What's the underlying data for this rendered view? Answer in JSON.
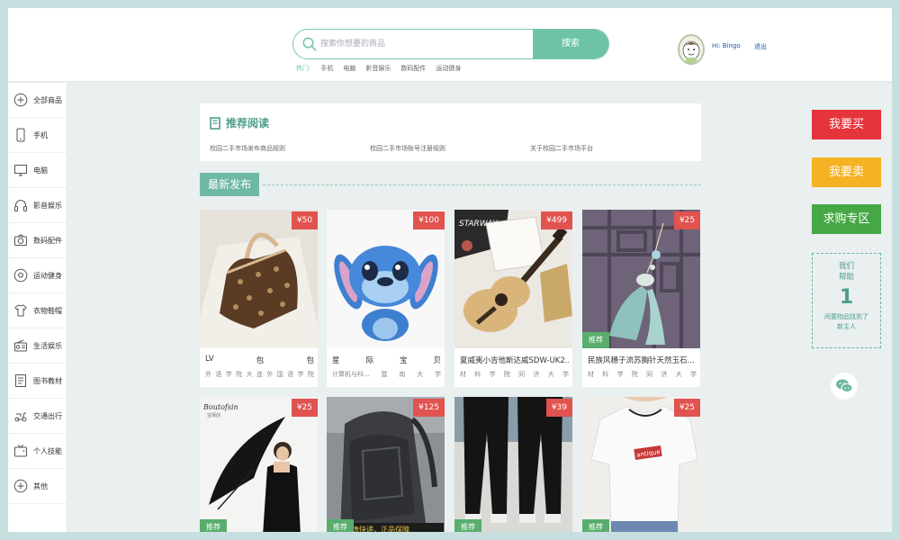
{
  "header": {
    "search": {
      "placeholder": "搜索你想要的商品",
      "button": "搜索"
    },
    "hot": {
      "label": "热门:",
      "items": [
        "手机",
        "电脑",
        "影音娱乐",
        "数码配件",
        "运动健身"
      ]
    },
    "user": {
      "greeting": "Hi: Bingo",
      "logout": "退出"
    }
  },
  "sidebar": {
    "items": [
      {
        "label": "全部商品",
        "icon": "plus-circle-icon"
      },
      {
        "label": "手机",
        "icon": "phone-icon"
      },
      {
        "label": "电脑",
        "icon": "monitor-icon"
      },
      {
        "label": "影音娱乐",
        "icon": "headphones-icon"
      },
      {
        "label": "数码配件",
        "icon": "camera-icon"
      },
      {
        "label": "运动健身",
        "icon": "ball-icon"
      },
      {
        "label": "衣物鞋帽",
        "icon": "shirt-icon"
      },
      {
        "label": "生活娱乐",
        "icon": "radio-icon"
      },
      {
        "label": "图书教材",
        "icon": "book-icon"
      },
      {
        "label": "交通出行",
        "icon": "scooter-icon"
      },
      {
        "label": "个人技能",
        "icon": "tv-icon"
      },
      {
        "label": "其他",
        "icon": "plus-circle-icon"
      }
    ]
  },
  "recommend": {
    "title": "推荐阅读",
    "links": [
      "校园二手市场发布商品规则",
      "校园二手市场账号注册规则",
      "关于校园二手市场平台"
    ]
  },
  "latest": {
    "title": "最新发布"
  },
  "products": [
    {
      "price": "¥50",
      "title": [
        "LV",
        "包",
        "包"
      ],
      "school": [
        "外",
        "语",
        "学",
        "院",
        "大",
        "连",
        "外",
        "国",
        "语",
        "学",
        "院"
      ],
      "tag": ""
    },
    {
      "price": "¥100",
      "title": [
        "星",
        "际",
        "宝",
        "贝"
      ],
      "school": [
        "计算机与科...",
        "暨",
        "南",
        "大",
        "学"
      ],
      "tag": ""
    },
    {
      "price": "¥499",
      "title": [
        "夏威夷小吉他斯达威SDW-UK2..."
      ],
      "school": [
        "材",
        "料",
        "学",
        "院",
        "同",
        "济",
        "大",
        "学"
      ],
      "tag": ""
    },
    {
      "price": "¥25",
      "title": [
        "民族风穗子流苏胸针天然玉石..."
      ],
      "school": [
        "材",
        "料",
        "学",
        "院",
        "同",
        "济",
        "大",
        "学"
      ],
      "tag": "推荐"
    },
    {
      "price": "¥25",
      "title": [
        ""
      ],
      "school": [],
      "tag": "推荐"
    },
    {
      "price": "¥125",
      "title": [
        ""
      ],
      "school": [],
      "tag": "推荐"
    },
    {
      "price": "¥39",
      "title": [
        ""
      ],
      "school": [],
      "tag": "推荐"
    },
    {
      "price": "¥25",
      "title": [
        ""
      ],
      "school": [],
      "tag": "推荐"
    }
  ],
  "product_banner": "安逸快递，正品保障",
  "right_panel": {
    "buy": "我要买",
    "sell": "我要卖",
    "wanted": "求购专区",
    "help_line1": "我们",
    "help_line2": "帮助",
    "help_count": "1",
    "help_line3": "闲置物品找到了",
    "help_line4": "新主人"
  },
  "colors": {
    "accent": "#6ec2a8",
    "price": "#e0534f",
    "buy": "#e6343d",
    "sell": "#f5b223",
    "wanted": "#45a845",
    "link": "#1a58b8"
  }
}
